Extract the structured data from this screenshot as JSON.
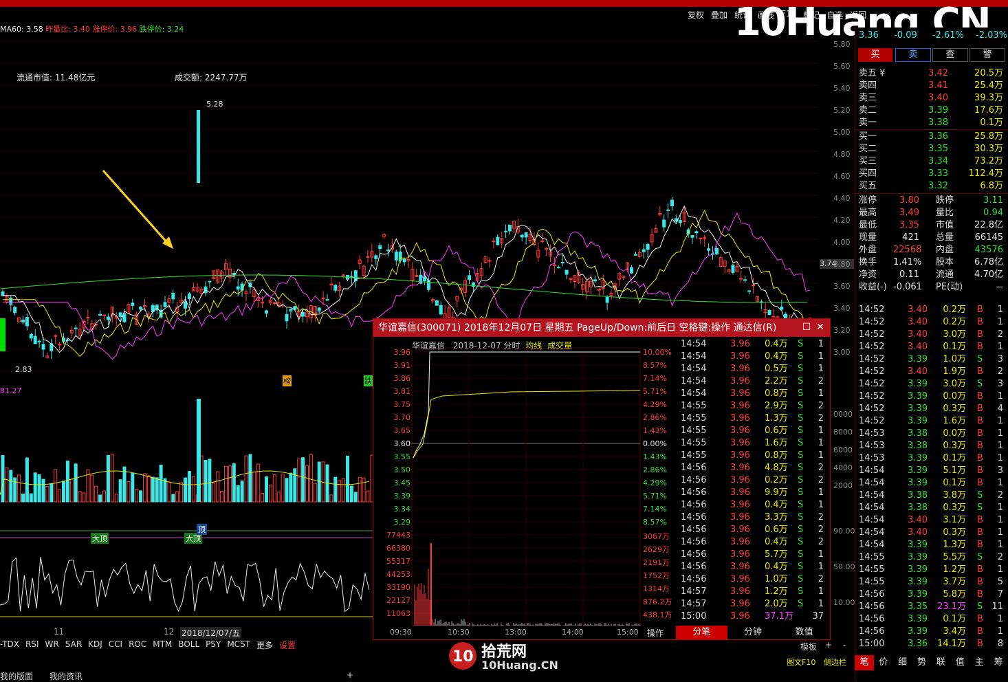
{
  "toolbar": {
    "buttons": [
      "复权",
      "叠加",
      "统计",
      "画线",
      "F10",
      "标记",
      "自选",
      "返回"
    ]
  },
  "ma_line": {
    "ma60_label": "MA60:",
    "ma60_value": "3.58",
    "prevvol_label": "昨量比:",
    "prevvol_value": "3.40",
    "upstop_label": "涨停价:",
    "upstop_value": "3.96",
    "downstop_label": "跌停价:",
    "downstop_value": "3.24"
  },
  "info": {
    "float_cap_label": "流通市值:",
    "float_cap": "11.48亿元",
    "amount_label": "成交额:",
    "amount": "2247.77万"
  },
  "chart_marks": {
    "high": "5.28",
    "low": "2.83",
    "vol_label": "81.27",
    "tag1": "榜",
    "tag2": "跌",
    "right_price": "3.74",
    "peak1": "大顶",
    "peak2": "大顶",
    "peak3": "顶"
  },
  "yaxis_ticks": [
    "5.80",
    "5.60",
    "5.40",
    "5.20",
    "5.00",
    "4.80",
    "4.60",
    "4.40",
    "4.20",
    "4.00",
    "3.80",
    "3.60",
    "3.40",
    "3.20",
    "3.00"
  ],
  "vol_ticks": [
    "0000",
    "8000",
    "6000",
    "4000",
    "2000"
  ],
  "ind_ticks": [
    "90.00",
    "50.00",
    "10.00"
  ],
  "time_axis": {
    "t1": "11",
    "t2": "12",
    "date": "2018/12/07/五"
  },
  "ind_tabs": [
    "-TDX",
    "RSI",
    "WR",
    "SAR",
    "KDJ",
    "CCI",
    "ROC",
    "MTM",
    "BOLL",
    "PSY",
    "MCST",
    "更多",
    "设置"
  ],
  "bottom_tabs": [
    "我的版面",
    "我的资讯",
    "+"
  ],
  "bottom_right": {
    "template": "模板",
    "plus": "+",
    "minus": "-",
    "f10": "图文F10",
    "sidebar": "侧边栏"
  },
  "logo": {
    "text": "10Huang.CN",
    "cn": "拾荒网",
    "small": "10Huang.CN"
  },
  "quote": {
    "price": "3.36",
    "change": "-0.09",
    "pct": "-2.61%",
    "amp": "-2.03%",
    "buy": "买",
    "sell": "卖",
    "query": "查",
    "alert": "警",
    "sells": [
      {
        "label": "卖五 ¥",
        "price": "3.42",
        "vol": "20.5万"
      },
      {
        "label": "卖四",
        "price": "3.41",
        "vol": "25.4万"
      },
      {
        "label": "卖三",
        "price": "3.40",
        "vol": "39.3万"
      },
      {
        "label": "卖二",
        "price": "3.39",
        "vol": "17.6万"
      },
      {
        "label": "卖一",
        "price": "3.38",
        "vol": "0.1万"
      }
    ],
    "buys": [
      {
        "label": "买一",
        "price": "3.36",
        "vol": "25.8万"
      },
      {
        "label": "买二",
        "price": "3.35",
        "vol": "30.3万"
      },
      {
        "label": "买三",
        "price": "3.34",
        "vol": "73.2万"
      },
      {
        "label": "买四",
        "price": "3.33",
        "vol": "112.4万"
      },
      {
        "label": "买五",
        "price": "3.32",
        "vol": "6.8万"
      }
    ],
    "stats": [
      [
        "涨停",
        "3.80",
        "跌停",
        "3.11"
      ],
      [
        "最高",
        "3.49",
        "量比",
        "0.94"
      ],
      [
        "最低",
        "3.35",
        "市值",
        "22.8亿"
      ],
      [
        "现量",
        "421",
        "总量",
        "66145"
      ],
      [
        "外盘",
        "22568",
        "内盘",
        "43576"
      ],
      [
        "换手",
        "1.41%",
        "股本",
        "6.78亿"
      ],
      [
        "净资",
        "0.11",
        "流通",
        "4.70亿"
      ],
      [
        "收益(-)",
        "-0.061",
        "PE(动)",
        "--"
      ]
    ],
    "ticks": [
      [
        "14:52",
        "3.40",
        "0.2万",
        "B",
        "1"
      ],
      [
        "14:52",
        "3.40",
        "0.2万",
        "B",
        "1"
      ],
      [
        "14:52",
        "3.40",
        "3.0万",
        "B",
        "2"
      ],
      [
        "14:52",
        "3.40",
        "0.1万",
        "B",
        "1"
      ],
      [
        "14:52",
        "3.39",
        "1.0万",
        "S",
        "3"
      ],
      [
        "14:52",
        "3.40",
        "1.9万",
        "B",
        "2"
      ],
      [
        "14:52",
        "3.39",
        "3.0万",
        "S",
        "3"
      ],
      [
        "14:52",
        "3.39",
        "0.0万",
        "B",
        "1"
      ],
      [
        "14:52",
        "3.39",
        "0.3万",
        "B",
        "4"
      ],
      [
        "14:52",
        "3.39",
        "1.6万",
        "B",
        "1"
      ],
      [
        "14:53",
        "3.38",
        "0.0万",
        "B",
        "1"
      ],
      [
        "14:53",
        "3.38",
        "0.3万",
        "B",
        "1"
      ],
      [
        "14:53",
        "3.39",
        "0.1万",
        "B",
        "1"
      ],
      [
        "14:54",
        "3.39",
        "5.1万",
        "B",
        "3"
      ],
      [
        "14:54",
        "3.39",
        "0.1万",
        "B",
        "1"
      ],
      [
        "14:54",
        "3.38",
        "3.8万",
        "S",
        "2"
      ],
      [
        "14:54",
        "3.38",
        "0.3万",
        "S",
        "1"
      ],
      [
        "14:54",
        "3.40",
        "3.1万",
        "B",
        "1"
      ],
      [
        "14:54",
        "3.40",
        "0.3万",
        "B",
        "1"
      ],
      [
        "14:54",
        "3.39",
        "1.3万",
        "B",
        "1"
      ],
      [
        "14:55",
        "3.39",
        "5.5万",
        "S",
        "2"
      ],
      [
        "14:55",
        "3.39",
        "1.2万",
        "B",
        "1"
      ],
      [
        "14:55",
        "3.39",
        "3.7万",
        "B",
        "5"
      ],
      [
        "14:56",
        "3.39",
        "5.8万",
        "B",
        "7"
      ],
      [
        "14:56",
        "3.35",
        "23.1万",
        "S",
        "11"
      ],
      [
        "14:56",
        "3.39",
        "0.1万",
        "B",
        "1"
      ],
      [
        "14:56",
        "3.39",
        "3.4万",
        "B",
        "1"
      ],
      [
        "15:00",
        "3.36",
        "14.1万",
        "B",
        "8"
      ]
    ],
    "tabs": [
      "笔",
      "价",
      "细",
      "势",
      "联",
      "值",
      "主",
      "筹"
    ]
  },
  "popup": {
    "title": "华谊嘉信(300071) 2018年12月07日 星期五 PageUp/Down:前后日 空格键:操作 通达信(R)",
    "sub_name": "华谊嘉信",
    "sub_date": "2018-12-07 分时",
    "sub_avg": "均线",
    "sub_vol": "成交量",
    "left_prices": [
      "3.96",
      "3.91",
      "3.86",
      "3.81",
      "3.75",
      "3.70",
      "3.65",
      "3.60",
      "3.55",
      "3.50",
      "3.45",
      "3.39",
      "3.34",
      "3.29"
    ],
    "right_pcts": [
      "10.00%",
      "8.57%",
      "7.14%",
      "5.71%",
      "4.29%",
      "2.86%",
      "1.43%",
      "0.00%",
      "1.43%",
      "2.86%",
      "4.29%",
      "5.71%",
      "7.14%",
      "8.57%"
    ],
    "vol_left": [
      "77443",
      "66380",
      "55317",
      "44253",
      "33190",
      "22127",
      "11063"
    ],
    "vol_right": [
      "3067万",
      "2629万",
      "2191万",
      "1752万",
      "1314万",
      "876.2万",
      "438.1万"
    ],
    "times": [
      "09:30",
      "10:30",
      "13:00",
      "14:00",
      "15:00"
    ],
    "op": "操作",
    "tabs": [
      "分笔",
      "分钟",
      "数值"
    ],
    "ticks": [
      [
        "14:54",
        "3.96",
        "0.4万",
        "S",
        "1"
      ],
      [
        "14:54",
        "3.96",
        "0.4万",
        "S",
        "1"
      ],
      [
        "14:54",
        "3.96",
        "0.5万",
        "S",
        "1"
      ],
      [
        "14:54",
        "3.96",
        "2.2万",
        "S",
        "2"
      ],
      [
        "14:54",
        "3.96",
        "0.8万",
        "S",
        "1"
      ],
      [
        "14:55",
        "3.96",
        "2.9万",
        "S",
        "2"
      ],
      [
        "14:55",
        "3.96",
        "1.3万",
        "S",
        "2"
      ],
      [
        "14:55",
        "3.96",
        "0.6万",
        "S",
        "1"
      ],
      [
        "14:55",
        "3.96",
        "1.6万",
        "S",
        "1"
      ],
      [
        "14:55",
        "3.96",
        "0.8万",
        "S",
        "1"
      ],
      [
        "14:56",
        "3.96",
        "4.8万",
        "S",
        "2"
      ],
      [
        "14:56",
        "3.96",
        "0.2万",
        "S",
        "2"
      ],
      [
        "14:56",
        "3.96",
        "9.9万",
        "S",
        "1"
      ],
      [
        "14:56",
        "3.96",
        "0.4万",
        "S",
        "1"
      ],
      [
        "14:56",
        "3.96",
        "3.3万",
        "S",
        "2"
      ],
      [
        "14:56",
        "3.96",
        "0.6万",
        "S",
        "2"
      ],
      [
        "14:56",
        "3.96",
        "0.4万",
        "S",
        "2"
      ],
      [
        "14:56",
        "3.96",
        "5.7万",
        "S",
        "1"
      ],
      [
        "14:56",
        "3.96",
        "0.4万",
        "S",
        "1"
      ],
      [
        "14:56",
        "3.96",
        "1.0万",
        "S",
        "2"
      ],
      [
        "14:57",
        "3.96",
        "1.2万",
        "S",
        "1"
      ],
      [
        "14:57",
        "3.96",
        "2.0万",
        "S",
        "1"
      ],
      [
        "15:00",
        "3.96",
        "37.1万",
        "",
        "37"
      ]
    ]
  }
}
